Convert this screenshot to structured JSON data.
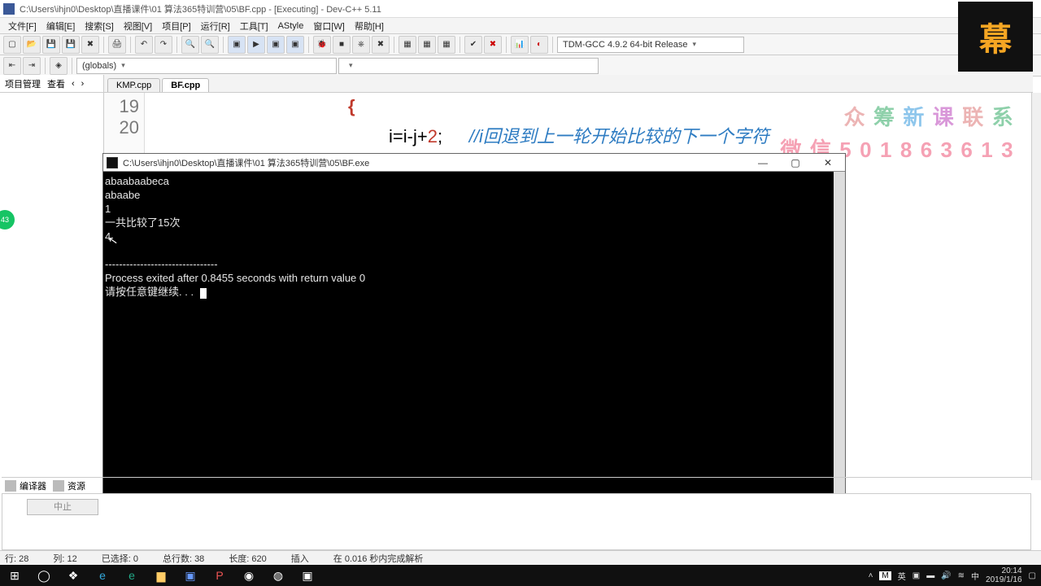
{
  "window": {
    "title": "C:\\Users\\ihjn0\\Desktop\\直播课件\\01 算法365特训营\\05\\BF.cpp - [Executing] - Dev-C++ 5.11"
  },
  "menu": [
    "文件[F]",
    "编辑[E]",
    "搜索[S]",
    "视图[V]",
    "项目[P]",
    "运行[R]",
    "工具[T]",
    "AStyle",
    "窗口[W]",
    "帮助[H]"
  ],
  "compiler_select": "TDM-GCC 4.9.2 64-bit Release",
  "scope_select": "(globals)",
  "project_tabs": [
    "项目管理",
    "查看",
    "‹",
    "›"
  ],
  "editor_tabs": [
    {
      "label": "KMP.cpp",
      "active": false
    },
    {
      "label": "BF.cpp",
      "active": true
    }
  ],
  "code": {
    "ln19": "19",
    "ln20": "20",
    "brace": "{",
    "expr_lhs": "i",
    "expr_eq": "=",
    "expr_i": "i",
    "expr_minus": "-",
    "expr_j": "j",
    "expr_plus": "+",
    "expr_2": "2",
    "expr_semi": ";",
    "comment": "//i回退到上一轮开始比较的下一个字符"
  },
  "watermark": {
    "line1": [
      "众",
      "筹",
      "新",
      "课",
      "联",
      "系"
    ],
    "line2": "微信501863613"
  },
  "console": {
    "title": "C:\\Users\\ihjn0\\Desktop\\直播课件\\01 算法365特训营\\05\\BF.exe",
    "lines": [
      "abaabaabeca",
      "abaabe",
      "1",
      "一共比较了15次",
      "4",
      "",
      "--------------------------------",
      "Process exited after 0.8455 seconds with return value 0",
      "请按任意键继续. . . "
    ]
  },
  "btm_tabs": [
    "编译器",
    "资源"
  ],
  "stop_btn": "中止",
  "status": {
    "line": "行:    28",
    "col": "列:    12",
    "sel": "已选择:    0",
    "tot": "总行数:    38",
    "len": "长度:    620",
    "ins": "插入",
    "parse": "在 0.016 秒内完成解析"
  },
  "logo": "幕",
  "badge": "43",
  "tray": {
    "ime1": "M",
    "ime2": "英",
    "ime3": "中",
    "time": "20:14",
    "date": "2019/1/16"
  }
}
